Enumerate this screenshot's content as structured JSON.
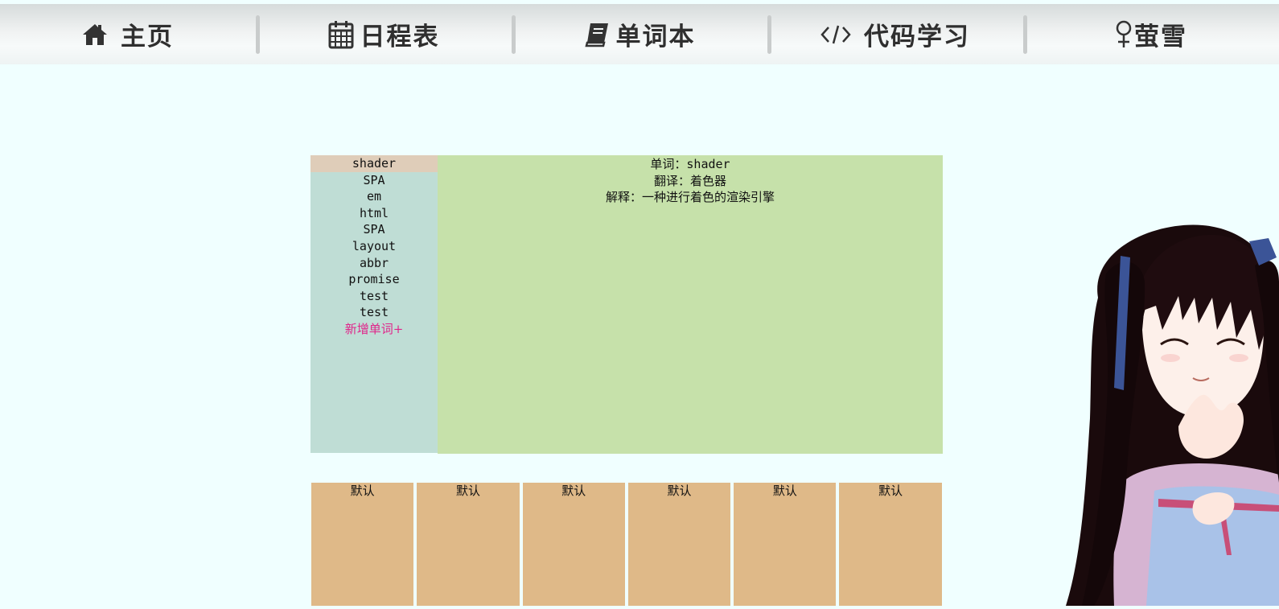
{
  "nav": {
    "items": [
      {
        "label": "主页",
        "icon": "home-icon"
      },
      {
        "label": "日程表",
        "icon": "calendar-icon"
      },
      {
        "label": "单词本",
        "icon": "book-icon"
      },
      {
        "label": "代码学习",
        "icon": "code-icon"
      },
      {
        "label": "萤雪",
        "icon": "female-icon"
      }
    ]
  },
  "word_list": {
    "items": [
      "shader",
      "SPA",
      "em",
      "html",
      "SPA",
      "layout",
      "abbr",
      "promise",
      "test",
      "test"
    ],
    "selected": "shader",
    "add_label": "新增单词+"
  },
  "detail": {
    "word_line": "单词：shader",
    "translation_line": "翻译：着色器",
    "explanation_line": "解释：一种进行着色的渲染引擎"
  },
  "cards": [
    "默认",
    "默认",
    "默认",
    "默认",
    "默认",
    "默认"
  ],
  "colors": {
    "page_bg": "#f0ffff",
    "list_bg": "#bfddd5",
    "selected_bg": "#dfcdb9",
    "detail_bg": "#c6e1aa",
    "card_bg": "#dfb988",
    "add_color": "#e0248a"
  }
}
